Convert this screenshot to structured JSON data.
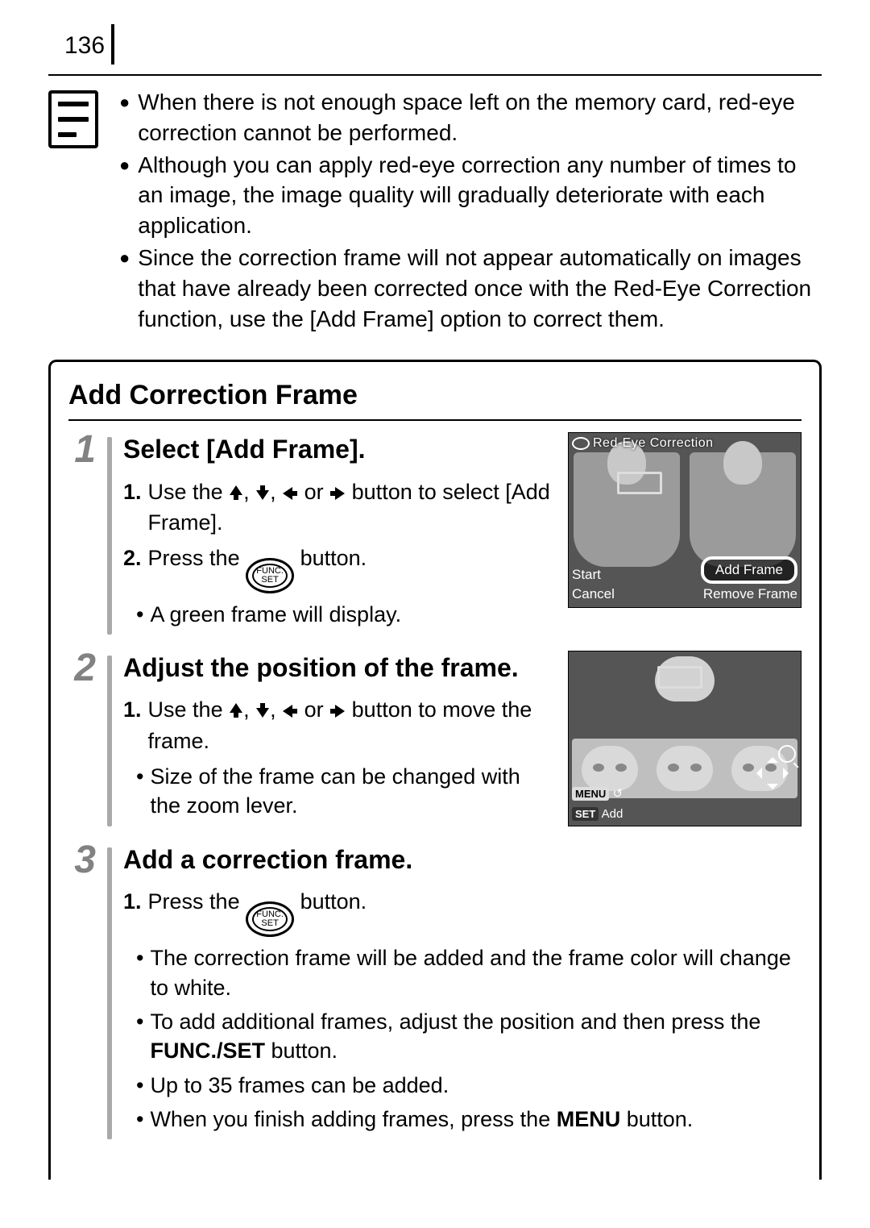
{
  "page_number": "136",
  "notes": [
    "When there is not enough space left on the memory card, red-eye correction cannot be performed.",
    "Although you can apply red-eye correction any number of times to an image, the image quality will gradually deteriorate with each application.",
    "Since the correction frame will not appear automatically on images that have already been corrected once with the Red-Eye Correction function, use the [Add Frame] option to correct them."
  ],
  "section_title": "Add Correction Frame",
  "steps": {
    "s1": {
      "num": "1",
      "title": "Select [Add Frame].",
      "i1_pre": "Use the ",
      "i1_post": " button to select [Add Frame].",
      "i2_pre": "Press the ",
      "i2_post": " button.",
      "bullet": "A green frame will display."
    },
    "s2": {
      "num": "2",
      "title": "Adjust the position of the frame.",
      "i1_pre": "Use the ",
      "i1_post": " button to move the frame.",
      "bullet": "Size of the frame can be changed with the zoom lever."
    },
    "s3": {
      "num": "3",
      "title": "Add a correction frame.",
      "i1_pre": "Press the ",
      "i1_post": " button.",
      "b1": "The correction frame will be added and the frame color will change to white.",
      "b2_pre": "To add additional frames, adjust the position and then press the ",
      "b2_strong": "FUNC./SET",
      "b2_post": " button.",
      "b3": "Up to 35 frames can be added.",
      "b4_pre": "When you finish adding frames, press the ",
      "b4_strong": "MENU",
      "b4_post": " button."
    }
  },
  "arrow_sep_or": " or ",
  "arrow_sep_comma": ",  ",
  "func_btn_top": "FUNC.",
  "func_btn_bot": "SET",
  "screen1": {
    "title": "Red-Eye Correction",
    "start": "Start",
    "cancel": "Cancel",
    "add_frame": "Add Frame",
    "remove_frame": "Remove Frame"
  },
  "screen2": {
    "menu_tag": "MENU",
    "menu_glyph": "↺",
    "set_tag": "SET",
    "set_label": "Add"
  }
}
